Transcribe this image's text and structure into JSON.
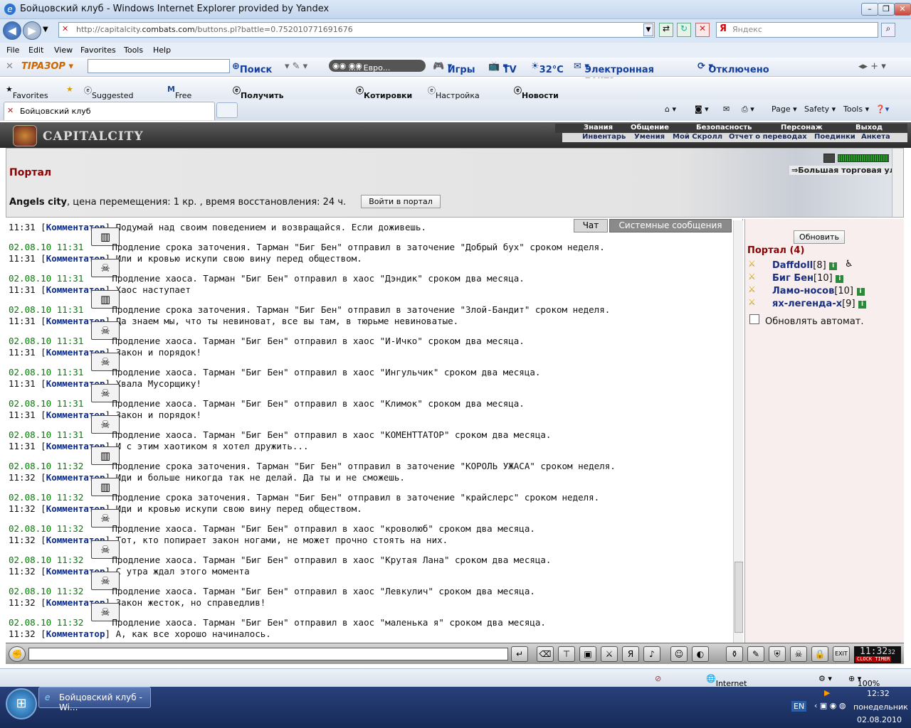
{
  "window": {
    "title": "Бойцовский клуб - Windows Internet Explorer provided by Yandex"
  },
  "address": {
    "url_prefix": "http://capitalcity.",
    "url_domain": "combats.com",
    "url_rest": "/buttons.pl?battle=0.752010771691676",
    "search_placeholder": "Яндекс"
  },
  "menu": [
    "File",
    "Edit",
    "View",
    "Favorites",
    "Tools",
    "Help"
  ],
  "toolbar": {
    "search": "Поиск",
    "radio": "..... Евро...",
    "games": "Игры",
    "tv": "TV",
    "weather": "32°C",
    "mail": "Электронная почта",
    "status": "Отключено"
  },
  "favorites": {
    "label": "Favorites",
    "items": [
      "Suggested Sites ▾",
      "Free Hotmail",
      "Получить больше до... ▾",
      "Котировки ▾",
      "Настройка ссылок",
      "Новости ▾"
    ]
  },
  "tabs": {
    "active": "Бойцовский клуб",
    "cmd_page": "Page ▾",
    "cmd_safety": "Safety ▾",
    "cmd_tools": "Tools ▾"
  },
  "game_nav": {
    "top": [
      "Знания",
      "Общение",
      "Безопасность",
      "Персонаж",
      "Выход"
    ],
    "bottom": [
      "Инвентарь",
      "Умения",
      "Мой Скролл",
      "Отчет о переводах",
      "Поединки",
      "Анкета"
    ]
  },
  "logo": "CAPITALCITY",
  "portal": {
    "title": "Портал",
    "city": "Angels city",
    "info": ", цена перемещения: 1 кр. , время восстановления: 24 ч.",
    "enter_button": "Войти в портал",
    "location": "Большая торговая ул."
  },
  "chat_tabs": {
    "chat": "Чат",
    "system": "Системные сообщения"
  },
  "chat": [
    {
      "type": "cmt",
      "time": "11:31",
      "author": "Комментатор",
      "text": "Подумай над своим поведением и возвращайся. Если доживешь."
    },
    {
      "type": "sys",
      "icon": "jail",
      "stamp": "02.08.10 11:31",
      "text": "Продление срока заточения. Тарман \"Биг Бен\" отправил в заточение \"Добрый бух\" сроком неделя."
    },
    {
      "type": "cmt",
      "time": "11:31",
      "author": "Комментатор",
      "text": "Или и кровью искупи свою вину перед обществом."
    },
    {
      "type": "sys",
      "icon": "chaos",
      "stamp": "02.08.10 11:31",
      "text": "Продление хаоса. Тарман \"Биг Бен\" отправил в хаос \"Дэндик\" сроком два месяца."
    },
    {
      "type": "cmt",
      "time": "11:31",
      "author": "Комментатор",
      "text": "Хаос наступает"
    },
    {
      "type": "sys",
      "icon": "jail",
      "stamp": "02.08.10 11:31",
      "text": "Продление срока заточения. Тарман \"Биг Бен\" отправил в заточение \"Злой-Бандит\" сроком неделя."
    },
    {
      "type": "cmt",
      "time": "11:31",
      "author": "Комментатор",
      "text": "Да знаем мы, что ты невиноват, все вы там, в тюрьме невиноватые."
    },
    {
      "type": "sys",
      "icon": "chaos",
      "stamp": "02.08.10 11:31",
      "text": "Продление хаоса. Тарман \"Биг Бен\" отправил в хаос \"И-Ичко\" сроком два месяца."
    },
    {
      "type": "cmt",
      "time": "11:31",
      "author": "Комментатор",
      "text": "Закон и порядок!"
    },
    {
      "type": "sys",
      "icon": "chaos",
      "stamp": "02.08.10 11:31",
      "text": "Продление хаоса. Тарман \"Биг Бен\" отправил в хаос \"Ингульчик\" сроком два месяца."
    },
    {
      "type": "cmt",
      "time": "11:31",
      "author": "Комментатор",
      "text": "Хвала Мусорщику!"
    },
    {
      "type": "sys",
      "icon": "chaos",
      "stamp": "02.08.10 11:31",
      "text": "Продление хаоса. Тарман \"Биг Бен\" отправил в хаос \"Климок\" сроком два месяца."
    },
    {
      "type": "cmt",
      "time": "11:31",
      "author": "Комментатор",
      "text": "Закон и порядок!"
    },
    {
      "type": "sys",
      "icon": "chaos",
      "stamp": "02.08.10 11:31",
      "text": "Продление хаоса. Тарман \"Биг Бен\" отправил в хаос \"КОМЕНТТАТОР\" сроком два месяца."
    },
    {
      "type": "cmt",
      "time": "11:31",
      "author": "Комментатор",
      "text": "И с этим хаотиком я хотел дружить..."
    },
    {
      "type": "sys",
      "icon": "jail",
      "stamp": "02.08.10 11:32",
      "text": "Продление срока заточения. Тарман \"Биг Бен\" отправил в заточение \"КОРОЛЬ УЖАСА\" сроком неделя."
    },
    {
      "type": "cmt",
      "time": "11:32",
      "author": "Комментатор",
      "text": "Иди и больше никогда так не делай. Да ты и не сможешь."
    },
    {
      "type": "sys",
      "icon": "jail",
      "stamp": "02.08.10 11:32",
      "text": "Продление срока заточения. Тарман \"Биг Бен\" отправил в заточение \"крайслерс\" сроком неделя."
    },
    {
      "type": "cmt",
      "time": "11:32",
      "author": "Комментатор",
      "text": "Иди и кровью искупи свою вину перед обществом."
    },
    {
      "type": "sys",
      "icon": "chaos",
      "stamp": "02.08.10 11:32",
      "text": "Продление хаоса. Тарман \"Биг Бен\" отправил в хаос \"кроволюб\" сроком два месяца."
    },
    {
      "type": "cmt",
      "time": "11:32",
      "author": "Комментатор",
      "text": "Тот, кто попирает закон ногами, не может прочно стоять на них."
    },
    {
      "type": "sys",
      "icon": "chaos",
      "stamp": "02.08.10 11:32",
      "text": "Продление хаоса. Тарман \"Биг Бен\" отправил в хаос \"Крутая Лана\" сроком два месяца."
    },
    {
      "type": "cmt",
      "time": "11:32",
      "author": "Комментатор",
      "text": "С утра ждал этого момента"
    },
    {
      "type": "sys",
      "icon": "chaos",
      "stamp": "02.08.10 11:32",
      "text": "Продление хаоса. Тарман \"Биг Бен\" отправил в хаос \"Левкулич\" сроком два месяца."
    },
    {
      "type": "cmt",
      "time": "11:32",
      "author": "Комментатор",
      "text": "Закон жесток, но справедлив!"
    },
    {
      "type": "sys",
      "icon": "chaos",
      "stamp": "02.08.10 11:32",
      "text": "Продление хаоса. Тарман \"Биг Бен\" отправил в хаос \"маленька я\" сроком два месяца."
    },
    {
      "type": "cmt",
      "time": "11:32",
      "author": "Комментатор",
      "text": "А, как все хорошо начиналось."
    }
  ],
  "sidebar": {
    "refresh": "Обновить",
    "heading": "Портал (4)",
    "users": [
      {
        "name": "Daffdoll",
        "level": "[8]"
      },
      {
        "name": "Биг Бен",
        "level": "[10]"
      },
      {
        "name": "Ламо-носов",
        "level": "[10]"
      },
      {
        "name": "ях-легенда-х",
        "level": "[9]"
      }
    ],
    "auto_refresh": "Обновлять автомат."
  },
  "clock": {
    "time": "11:32",
    "sec": "32",
    "label1": "CLOCK",
    "label2": "TIMER"
  },
  "statusbar": {
    "zone": "Internet",
    "zoom": "100%"
  },
  "taskbar": {
    "item": "Бойцовский клуб - Wi...",
    "lang": "EN",
    "time": "12:32",
    "day": "понедельник",
    "date": "02.08.2010"
  }
}
